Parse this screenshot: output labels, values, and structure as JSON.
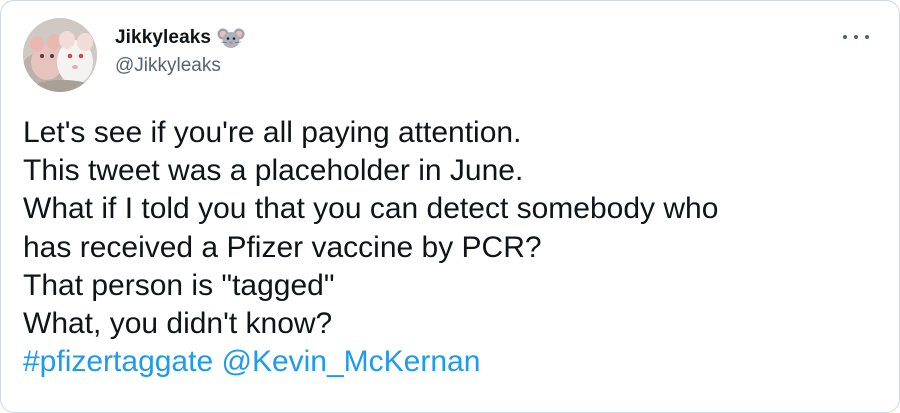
{
  "user": {
    "display_name": "Jikkyleaks",
    "handle": "@Jikkyleaks",
    "badge_emoji_icon": "mouse-face-icon",
    "avatar_icon": "white-mice-avatar"
  },
  "menu": {
    "more_icon": "more-options-icon"
  },
  "tweet": {
    "lines": [
      "Let's see if you're all paying attention.",
      "This tweet was a placeholder in June.",
      "What if I told you that you can detect somebody who",
      "has received a Pfizer vaccine by PCR?",
      "That person is \"tagged\"",
      "What, you didn't know?"
    ],
    "hashtag": "#pfizertaggate",
    "mention": "@Kevin_McKernan"
  },
  "colors": {
    "link": "#1d9bf0",
    "text": "#0f1419",
    "secondary": "#536471",
    "border": "#cfd9de"
  }
}
